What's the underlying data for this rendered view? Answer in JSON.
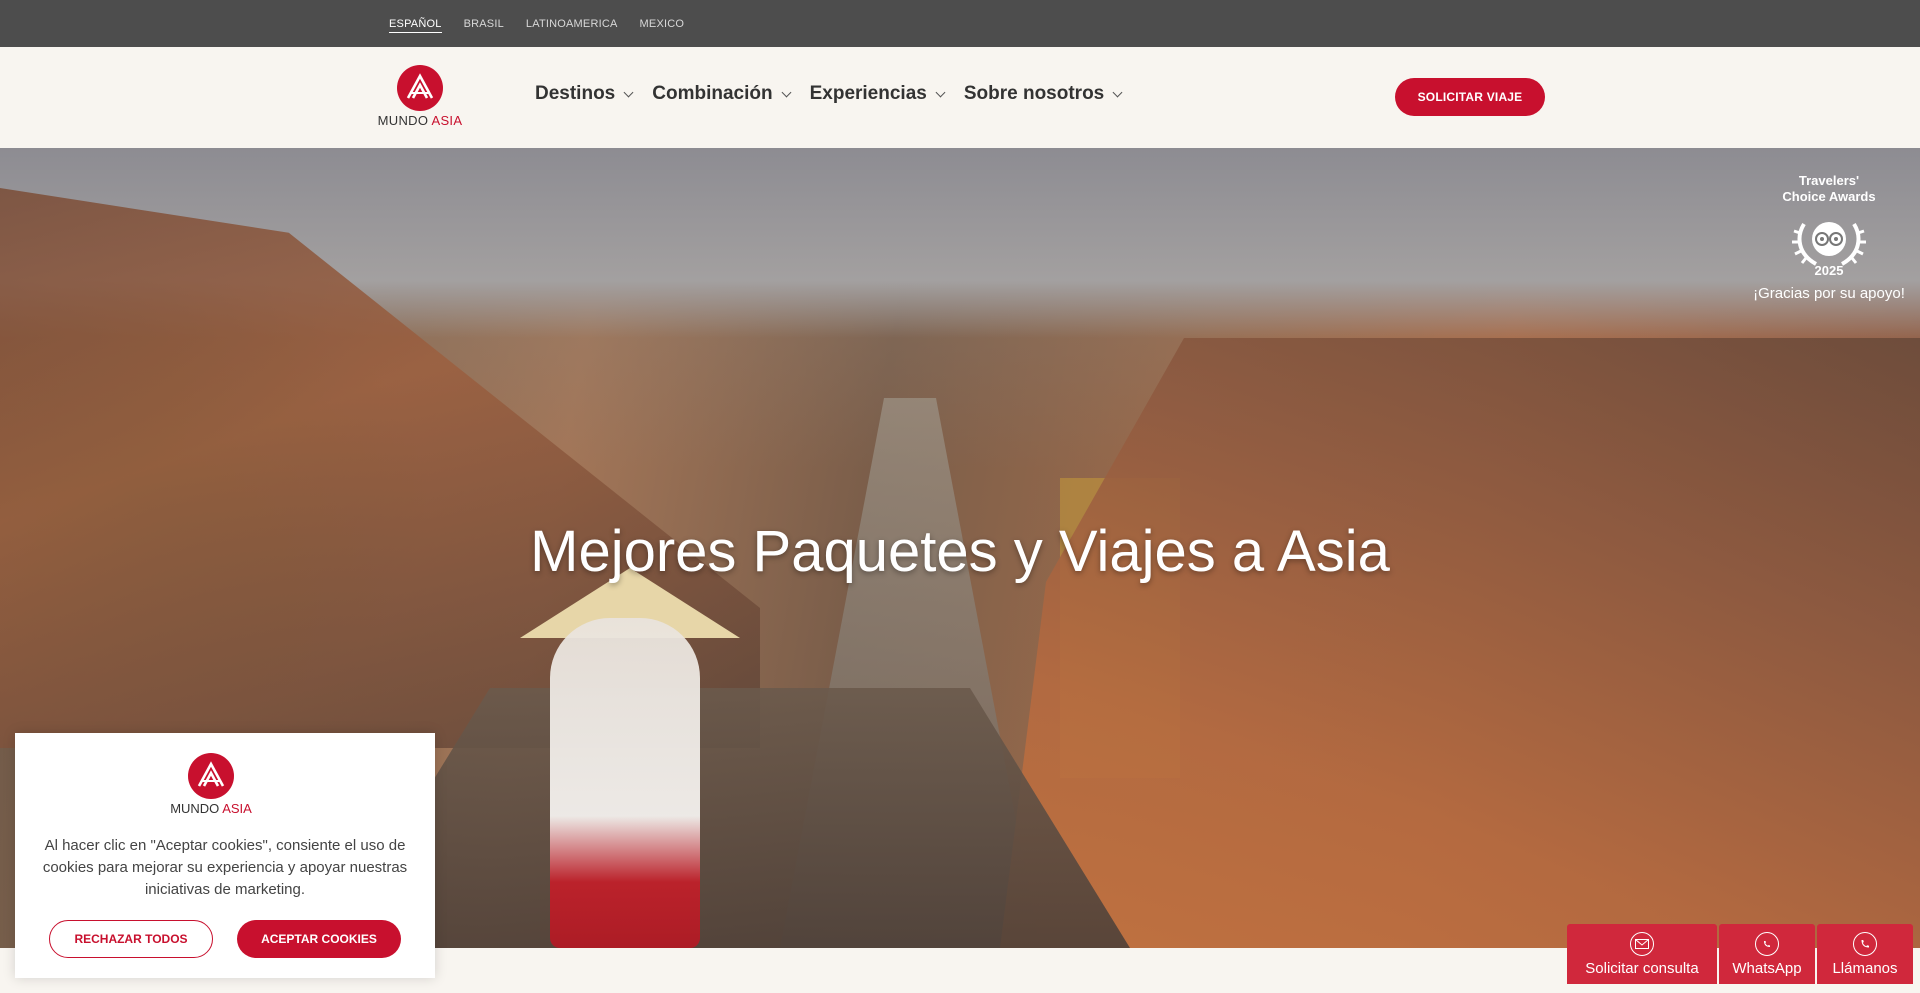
{
  "languages": {
    "items": [
      "ESPAÑOL",
      "BRASIL",
      "LATINOAMERICA",
      "MEXICO"
    ],
    "active": "ESPAÑOL"
  },
  "logo": {
    "word_main": "MUNDO ",
    "word_accent": "ASIA"
  },
  "nav": {
    "items": [
      {
        "label": "Destinos"
      },
      {
        "label": "Combinación"
      },
      {
        "label": "Experiencias"
      },
      {
        "label": "Sobre nosotros"
      }
    ],
    "cta_label": "SOLICITAR VIAJE"
  },
  "hero": {
    "title": "Mejores Paquetes y Viajes a Asia"
  },
  "award": {
    "title_line1": "Travelers'",
    "title_line2": "Choice Awards",
    "year": "2025",
    "thanks": "¡Gracias por su apoyo!"
  },
  "cookie": {
    "text": "Al hacer clic en \"Aceptar cookies\", consiente el uso de cookies para mejorar su experiencia y apoyar nuestras iniciativas de marketing.",
    "reject_label": "RECHAZAR TODOS",
    "accept_label": "ACEPTAR COOKIES"
  },
  "floatbar": {
    "consulta_label": "Solicitar consulta",
    "whatsapp_label": "WhatsApp",
    "llamanos_label": "Llámanos"
  },
  "colors": {
    "brand_red": "#c8102e",
    "topbar": "#4d4d4d",
    "header_bg": "#f8f5f0"
  },
  "icons": [
    "mail-icon",
    "whatsapp-icon",
    "phone-icon",
    "chevron-down-icon",
    "tripadvisor-laurel-icon",
    "mundo-asia-logo"
  ]
}
